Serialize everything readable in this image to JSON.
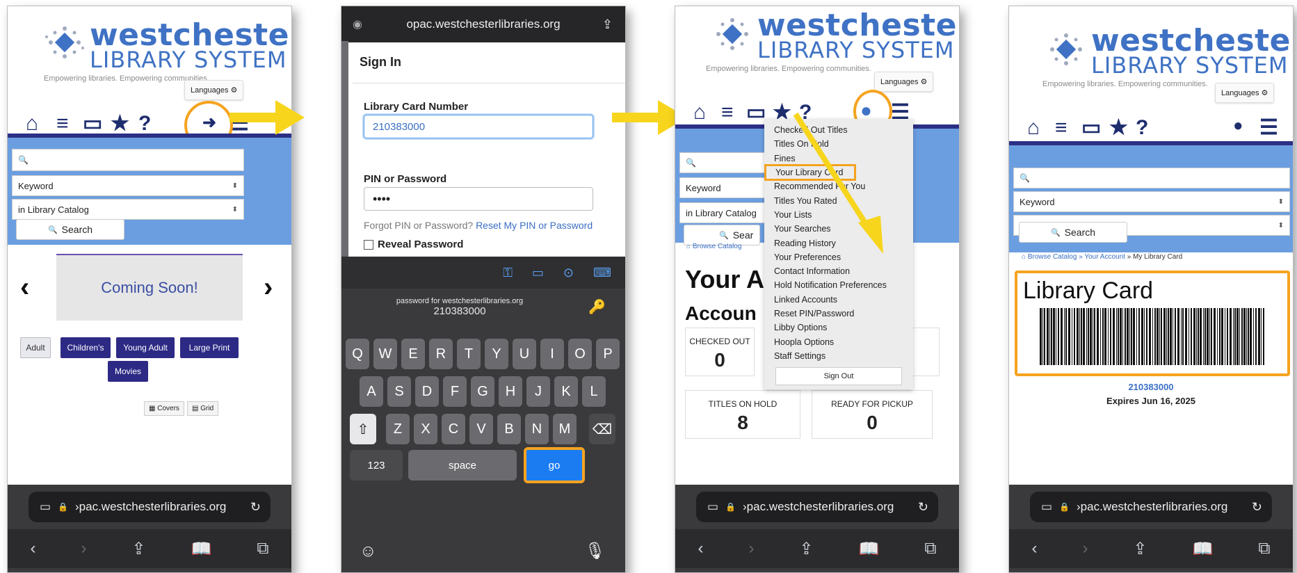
{
  "logo": {
    "word1": "westchester",
    "word2": "LIBRARY SYSTEM",
    "tagline": "Empowering libraries. Empowering communities."
  },
  "languages_label": "Languages",
  "nav": {
    "home": "⌂",
    "browse": "≡",
    "computer": "▭",
    "star": "★",
    "help": "?",
    "signin": "➜",
    "menu": "☰",
    "account": "👤"
  },
  "search": {
    "icon": "🔍",
    "keyword": "Keyword",
    "scope": "in Library Catalog",
    "search_label": "Search",
    "search_label_cut": "Sear"
  },
  "phone1": {
    "carousel_text": "Coming Soon!",
    "left_arrow": "‹",
    "right_arrow": "›",
    "categories": [
      "Adult",
      "Children's",
      "Young Adult",
      "Large Print",
      "Movies"
    ],
    "covers_label": "Covers",
    "grid_label": "Grid"
  },
  "browser": {
    "url": "›pac.westchesterlibraries.org",
    "reload": "↻"
  },
  "phone2": {
    "url": "opac.westchesterlibraries.org",
    "title": "Sign In",
    "card_label": "Library Card Number",
    "card_value": "210383000",
    "pin_label": "PIN or Password",
    "pin_value": "••••",
    "forgot_text": "Forgot PIN or Password?",
    "reset_link": "Reset My PIN or Password",
    "reveal_label": "Reveal Password",
    "autofill_hint": "password for westchesterlibraries.org",
    "autofill_user": "210383000",
    "rows": [
      [
        "Q",
        "W",
        "E",
        "R",
        "T",
        "Y",
        "U",
        "I",
        "O",
        "P"
      ],
      [
        "A",
        "S",
        "D",
        "F",
        "G",
        "H",
        "J",
        "K",
        "L"
      ],
      [
        "Z",
        "X",
        "C",
        "V",
        "B",
        "N",
        "M"
      ]
    ],
    "key_123": "123",
    "key_space": "space",
    "key_go": "go"
  },
  "phone3": {
    "menu": [
      "Checked Out Titles",
      "Titles On Hold",
      "Fines",
      "Your Library Card",
      "Recommended For You",
      "Titles You Rated",
      "Your Lists",
      "Your Searches",
      "Reading History",
      "Your Preferences",
      "Contact Information",
      "Hold Notification Preferences",
      "Linked Accounts",
      "Reset PIN/Password",
      "Libby Options",
      "Hoopla Options",
      "Staff Settings"
    ],
    "sign_out": "Sign Out",
    "browse_crumb": "Browse Catalog",
    "your_a": "Your A",
    "accoun": "Accoun",
    "checked_out_label": "CHECKED OUT",
    "checked_out_value": "0",
    "on_hold_label": "TITLES ON HOLD",
    "on_hold_value": "8",
    "pickup_label": "READY FOR PICKUP",
    "pickup_value": "0"
  },
  "phone4": {
    "crumb1": "Browse Catalog",
    "crumb2": "» Your Account",
    "crumb3": "» My Library Card",
    "card_title": "Library Card",
    "card_number": "210383000",
    "expires": "Expires Jun 16, 2025"
  },
  "colors": {
    "highlight": "#f5a320",
    "arrow": "#f7d51d",
    "navy": "#2c2f86",
    "band": "#6b9ee0"
  }
}
